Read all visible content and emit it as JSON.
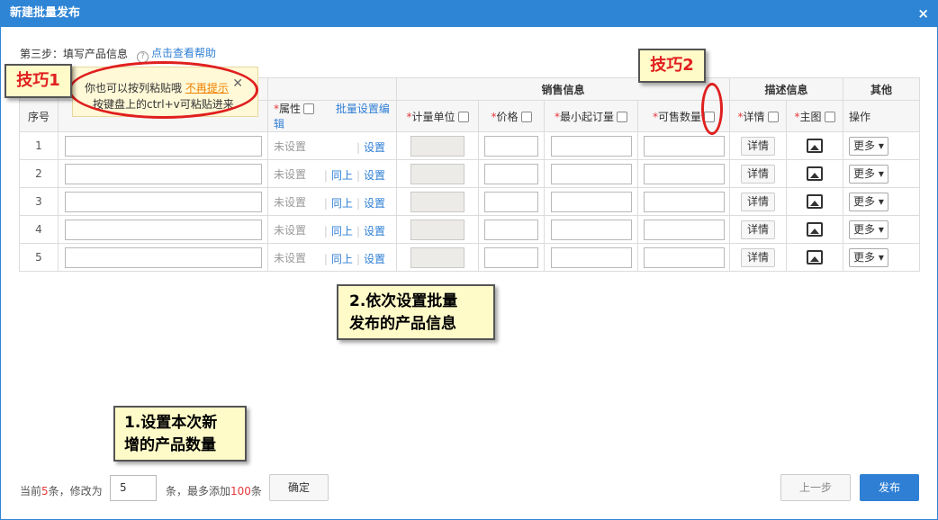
{
  "window": {
    "title": "新建批量发布",
    "close": "×"
  },
  "step": {
    "label": "第三步：填写产品信息",
    "help": "点击查看帮助",
    "help_icon": "?"
  },
  "table": {
    "group_headers": {
      "sales": "销售信息",
      "desc": "描述信息",
      "other": "其他"
    },
    "cols": {
      "index": "序号",
      "attr": "属性",
      "batch_edit": "批量设置编辑",
      "unit": "计量单位",
      "price": "价格",
      "min_order": "最小起订量",
      "stock": "可售数量",
      "detail": "详情",
      "main_img": "主图",
      "op": "操作"
    },
    "rows": [
      {
        "index": "1"
      },
      {
        "index": "2"
      },
      {
        "index": "3"
      },
      {
        "index": "4"
      },
      {
        "index": "5"
      }
    ],
    "cell": {
      "unset": "未设置",
      "same_above": "同上",
      "set": "设置",
      "detail_btn": "详情",
      "more_btn": "更多"
    }
  },
  "tooltip": {
    "line1": "你也可以按列粘贴哦",
    "no_remind": "不再提示",
    "line2": "按键盘上的ctrl+v可粘贴进来",
    "close": "✕"
  },
  "annotations": {
    "tip1": "技巧1",
    "tip2": "技巧2",
    "note2_l1": "2.依次设置批量",
    "note2_l2": "发布的产品信息",
    "note1_l1": "1.设置本次新",
    "note1_l2": "增的产品数量"
  },
  "footer": {
    "current_prefix": "当前",
    "current_count": "5",
    "current_suffix": "条，修改为",
    "count_value": "5",
    "max_prefix": "条，最多添加",
    "max_count": "100",
    "max_suffix": "条",
    "confirm": "确定",
    "prev": "上一步",
    "publish": "发布"
  }
}
